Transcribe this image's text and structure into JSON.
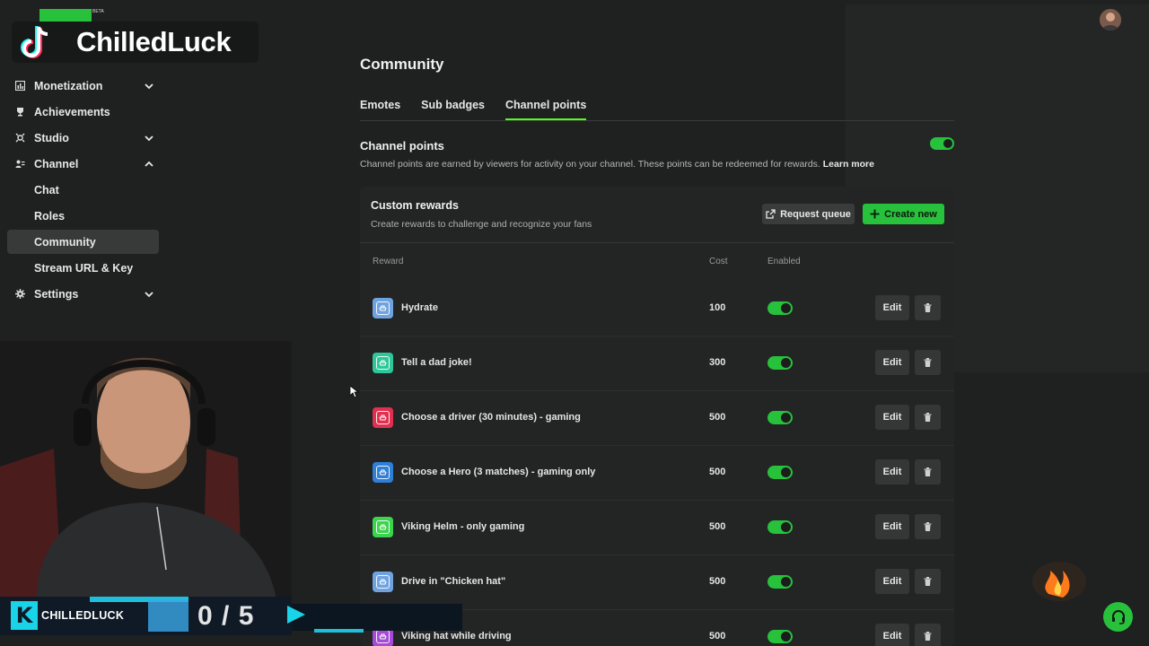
{
  "overlay": {
    "brand_name": "ChilledLuck",
    "beta_label": "BETA",
    "kick_name": "CHILLEDLUCK",
    "goal_count": "0 / 5",
    "kick_logo": "K"
  },
  "sidebar": {
    "items": [
      {
        "label": "Monetization",
        "icon": "monetization-icon",
        "expandable": true,
        "expanded": false
      },
      {
        "label": "Achievements",
        "icon": "trophy-icon",
        "expandable": false
      },
      {
        "label": "Studio",
        "icon": "studio-icon",
        "expandable": true,
        "expanded": false
      },
      {
        "label": "Channel",
        "icon": "channel-icon",
        "expandable": true,
        "expanded": true
      },
      {
        "label": "Settings",
        "icon": "gear-icon",
        "expandable": true,
        "expanded": false
      }
    ],
    "channel_sub": [
      {
        "label": "Chat"
      },
      {
        "label": "Roles"
      },
      {
        "label": "Community",
        "active": true
      },
      {
        "label": "Stream URL & Key"
      }
    ]
  },
  "main": {
    "title": "Community",
    "tabs": [
      {
        "label": "Emotes"
      },
      {
        "label": "Sub badges"
      },
      {
        "label": "Channel points",
        "active": true
      }
    ],
    "channel_points": {
      "title": "Channel points",
      "description": "Channel points are earned by viewers for activity on your channel. These points can be redeemed for rewards.",
      "learn_more": "Learn more",
      "enabled": true
    },
    "custom_rewards": {
      "title": "Custom rewards",
      "subtitle": "Create rewards to challenge and recognize your fans",
      "request_queue_label": "Request queue",
      "create_new_label": "Create new",
      "columns": {
        "reward": "Reward",
        "cost": "Cost",
        "enabled": "Enabled"
      },
      "edit_label": "Edit",
      "rows": [
        {
          "name": "Hydrate",
          "cost": "100",
          "enabled": true,
          "color": "#6fa3e0"
        },
        {
          "name": "Tell a dad joke!",
          "cost": "300",
          "enabled": true,
          "color": "#2ec79a"
        },
        {
          "name": "Choose a driver (30 minutes) - gaming",
          "cost": "500",
          "enabled": true,
          "color": "#e1304f"
        },
        {
          "name": "Choose a Hero (3 matches) - gaming only",
          "cost": "500",
          "enabled": true,
          "color": "#2f7fd6"
        },
        {
          "name": "Viking Helm - only gaming",
          "cost": "500",
          "enabled": true,
          "color": "#3cd44e"
        },
        {
          "name": "Drive in \"Chicken hat\"",
          "cost": "500",
          "enabled": true,
          "color": "#6fa3e0"
        },
        {
          "name": "Viking hat while driving",
          "cost": "500",
          "enabled": true,
          "color": "#a64ad8"
        }
      ]
    }
  },
  "colors": {
    "accent": "#27c13c",
    "tab_underline": "#53fc18",
    "background": "#1f2020",
    "card": "#232424"
  }
}
